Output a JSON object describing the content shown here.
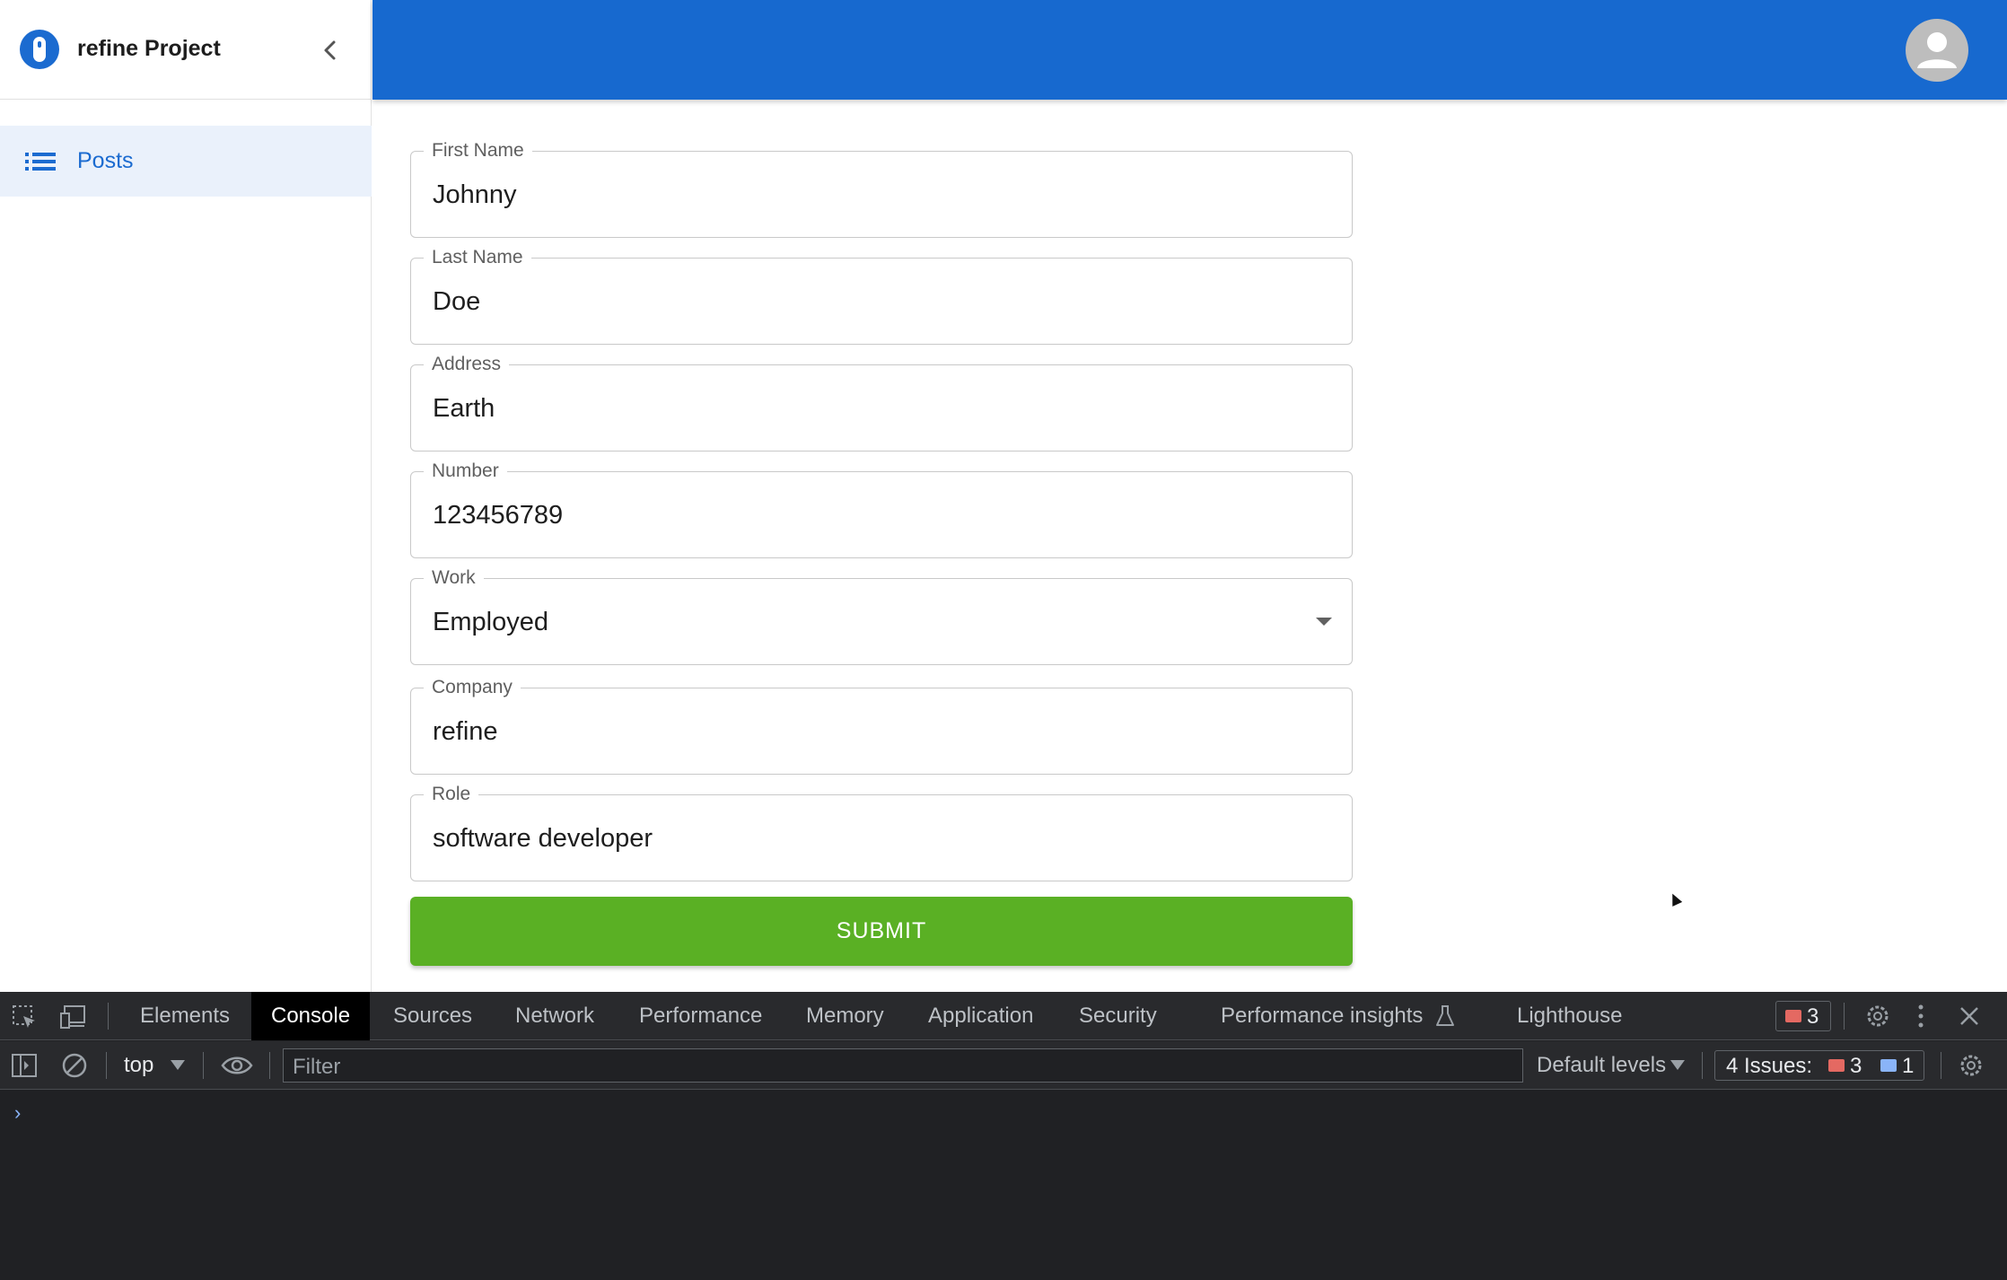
{
  "sidebar": {
    "app_title": "refine Project",
    "items": [
      {
        "label": "Posts",
        "icon": "list-icon"
      }
    ]
  },
  "form": {
    "fields": [
      {
        "label": "First Name",
        "value": "Johnny"
      },
      {
        "label": "Last Name",
        "value": "Doe"
      },
      {
        "label": "Address",
        "value": "Earth"
      },
      {
        "label": "Number",
        "value": "123456789"
      },
      {
        "label": "Work",
        "value": "Employed"
      },
      {
        "label": "Company",
        "value": "refine"
      },
      {
        "label": "Role",
        "value": "software developer"
      }
    ],
    "submit_label": "SUBMIT"
  },
  "devtools": {
    "tabs": [
      "Elements",
      "Console",
      "Sources",
      "Network",
      "Performance",
      "Memory",
      "Application",
      "Security",
      "Performance insights",
      "Lighthouse"
    ],
    "active_tab": "Console",
    "error_count": "3",
    "context": "top",
    "filter_placeholder": "Filter",
    "levels": "Default levels",
    "issues_label": "4 Issues:",
    "issues_errors": "3",
    "issues_info": "1",
    "prompt": "›"
  },
  "colors": {
    "primary": "#1769cf",
    "submit": "#5ab024",
    "devtools_bg": "#202124"
  }
}
